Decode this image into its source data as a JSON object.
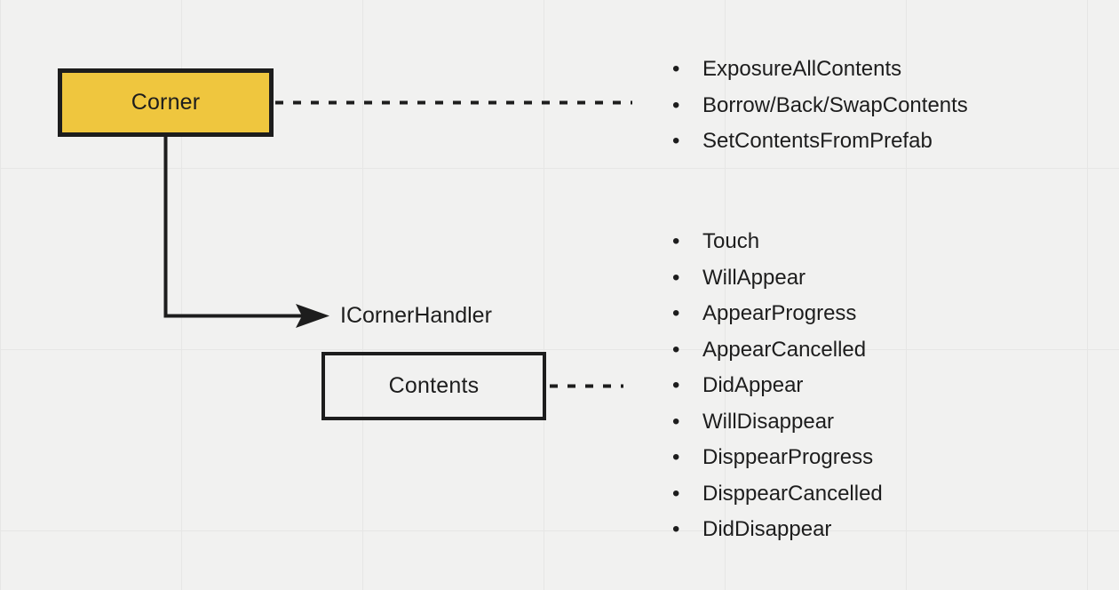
{
  "diagram": {
    "background_color": "#f1f1f0",
    "grid_color": "#e6e6e5",
    "nodes": [
      {
        "id": "corner",
        "label": "Corner",
        "fill_color": "#efc63e",
        "border_color": "#1d1d1d"
      },
      {
        "id": "contents",
        "label": "Contents",
        "fill_color": "transparent",
        "border_color": "#1d1d1d"
      }
    ],
    "interface_label": "ICornerHandler",
    "connectors": [
      {
        "id": "corner-to-api",
        "style": "dashed",
        "from": "corner",
        "to": "api-list"
      },
      {
        "id": "corner-to-icornerhandler",
        "style": "solid-arrow",
        "from": "corner",
        "to": "ICornerHandler"
      },
      {
        "id": "contents-to-events",
        "style": "dashed",
        "from": "contents",
        "to": "events-list"
      }
    ],
    "api_list": {
      "bullet": "•",
      "items": [
        "ExposureAllContents",
        "Borrow/Back/SwapContents",
        "SetContentsFromPrefab"
      ]
    },
    "events_list": {
      "bullet": "•",
      "items": [
        "Touch",
        "WillAppear",
        "AppearProgress",
        "AppearCancelled",
        "DidAppear",
        "WillDisappear",
        "DisppearProgress",
        "DisppearCancelled",
        "DidDisappear"
      ]
    }
  }
}
